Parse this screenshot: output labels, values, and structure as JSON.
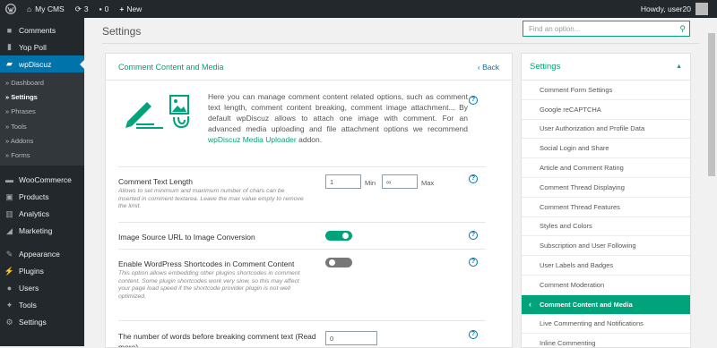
{
  "adminbar": {
    "wp_icon": "wordpress-logo-icon",
    "site_name": "My CMS",
    "updates_count": "3",
    "comments_count": "0",
    "new_label": "New",
    "howdy": "Howdy, user20"
  },
  "sidebar": {
    "items": [
      {
        "label": "Comments",
        "icon": "comments-icon"
      },
      {
        "label": "Yop Poll",
        "icon": "poll-icon"
      },
      {
        "label": "wpDiscuz",
        "icon": "wpdiscuz-icon"
      }
    ],
    "submenu": [
      "» Dashboard",
      "» Settings",
      "» Phrases",
      "» Tools",
      "» Addons",
      "» Forms"
    ],
    "items2": [
      {
        "label": "WooCommerce",
        "icon": "woocommerce-icon"
      },
      {
        "label": "Products",
        "icon": "products-icon"
      },
      {
        "label": "Analytics",
        "icon": "analytics-icon"
      },
      {
        "label": "Marketing",
        "icon": "marketing-icon"
      }
    ],
    "items3": [
      {
        "label": "Appearance",
        "icon": "appearance-icon"
      },
      {
        "label": "Plugins",
        "icon": "plugins-icon"
      },
      {
        "label": "Users",
        "icon": "users-icon"
      },
      {
        "label": "Tools",
        "icon": "tools-icon"
      },
      {
        "label": "Settings",
        "icon": "settings-icon"
      }
    ]
  },
  "page": {
    "title": "Settings",
    "search_placeholder": "Find an option..."
  },
  "panel": {
    "title": "Comment Content and Media",
    "back": "‹ Back",
    "intro_text": "Here you can manage comment content related options, such as comment text length, comment content breaking, comment image attachment... By default wpDiscuz allows to attach one image with comment. For an advanced media uploading and file attachment options we recommend",
    "intro_link": "wpDiscuz Media Uploader",
    "intro_tail": " addon.",
    "help": "?",
    "rows": {
      "text_length": {
        "label": "Comment Text Length",
        "desc": "Allows to set minimum and maximum number of chars can be inserted in comment textarea. Leave the max value empty to remove the limit.",
        "min_value": "1",
        "min_label": "Min",
        "max_value": "∞",
        "max_label": "Max"
      },
      "image_source": {
        "label": "Image Source URL to Image Conversion",
        "enabled": true
      },
      "shortcodes": {
        "label": "Enable WordPress Shortcodes in Comment Content",
        "desc": "This option allows embedding other plugins shortcodes in comment content. Some plugin shortcodes work very slow, so this may affect your page load speed if the shortcode provider plugin is not well optimized.",
        "enabled": false
      },
      "words_break": {
        "label": "The number of words before breaking comment text (Read more)",
        "value": "0"
      }
    }
  },
  "sidenav": {
    "title": "Settings",
    "items": [
      "Comment Form Settings",
      "Google reCAPTCHA",
      "User Authorization and Profile Data",
      "Social Login and Share",
      "Article and Comment Rating",
      "Comment Thread Displaying",
      "Comment Thread Features",
      "Styles and Colors",
      "Subscription and User Following",
      "User Labels and Badges",
      "Comment Moderation",
      "Comment Content and Media",
      "Live Commenting and Notifications",
      "Inline Commenting"
    ],
    "active_index": 11
  },
  "colors": {
    "accent": "#00a37a",
    "admin_bar": "#23282d",
    "menu_current": "#0073aa"
  }
}
